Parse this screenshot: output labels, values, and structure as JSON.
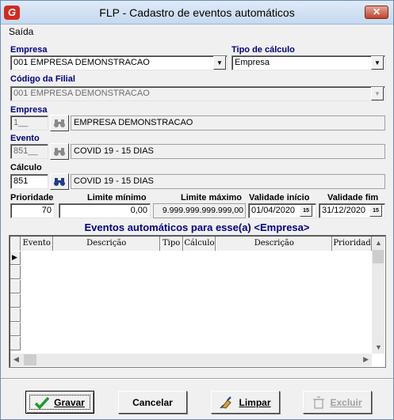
{
  "window": {
    "title": "FLP - Cadastro de eventos automáticos",
    "close": "✕",
    "logo": "G"
  },
  "menu": {
    "saida": "Saída"
  },
  "empresa_top": {
    "label": "Empresa",
    "value": "001 EMPRESA DEMONSTRACAO"
  },
  "tipo_calculo": {
    "label": "Tipo de cálculo",
    "value": "Empresa"
  },
  "codigo_filial": {
    "label": "Código da Filial",
    "value": "001 EMPRESA DEMONSTRACAO"
  },
  "empresa": {
    "label": "Empresa",
    "code": "1__",
    "name": "EMPRESA DEMONSTRACAO"
  },
  "evento": {
    "label": "Evento",
    "code": "851__",
    "name": "COVID 19 - 15 DIAS"
  },
  "calculo": {
    "label": "Cálculo",
    "code": "851",
    "name": "COVID 19 - 15 DIAS"
  },
  "row_fields": {
    "prioridade": {
      "label": "Prioridade",
      "value": "70"
    },
    "limite_minimo": {
      "label": "Limite mínimo",
      "value": "0,00"
    },
    "limite_maximo": {
      "label": "Limite máximo",
      "value": "9.999.999.999.999,00"
    },
    "validade_inicio": {
      "label": "Validade início",
      "value": "01/04/2020"
    },
    "validade_fim": {
      "label": "Validade fim",
      "value": "31/12/2020"
    },
    "calendar_glyph": "15"
  },
  "grid": {
    "title": "Eventos automáticos para esse(a) <Empresa>",
    "columns": [
      "Evento",
      "Descrição",
      "Tipo",
      "Cálculo",
      "Descrição",
      "Prioridade"
    ]
  },
  "buttons": {
    "gravar": "Gravar",
    "cancelar": "Cancelar",
    "limpar": "Limpar",
    "excluir": "Excluir"
  }
}
